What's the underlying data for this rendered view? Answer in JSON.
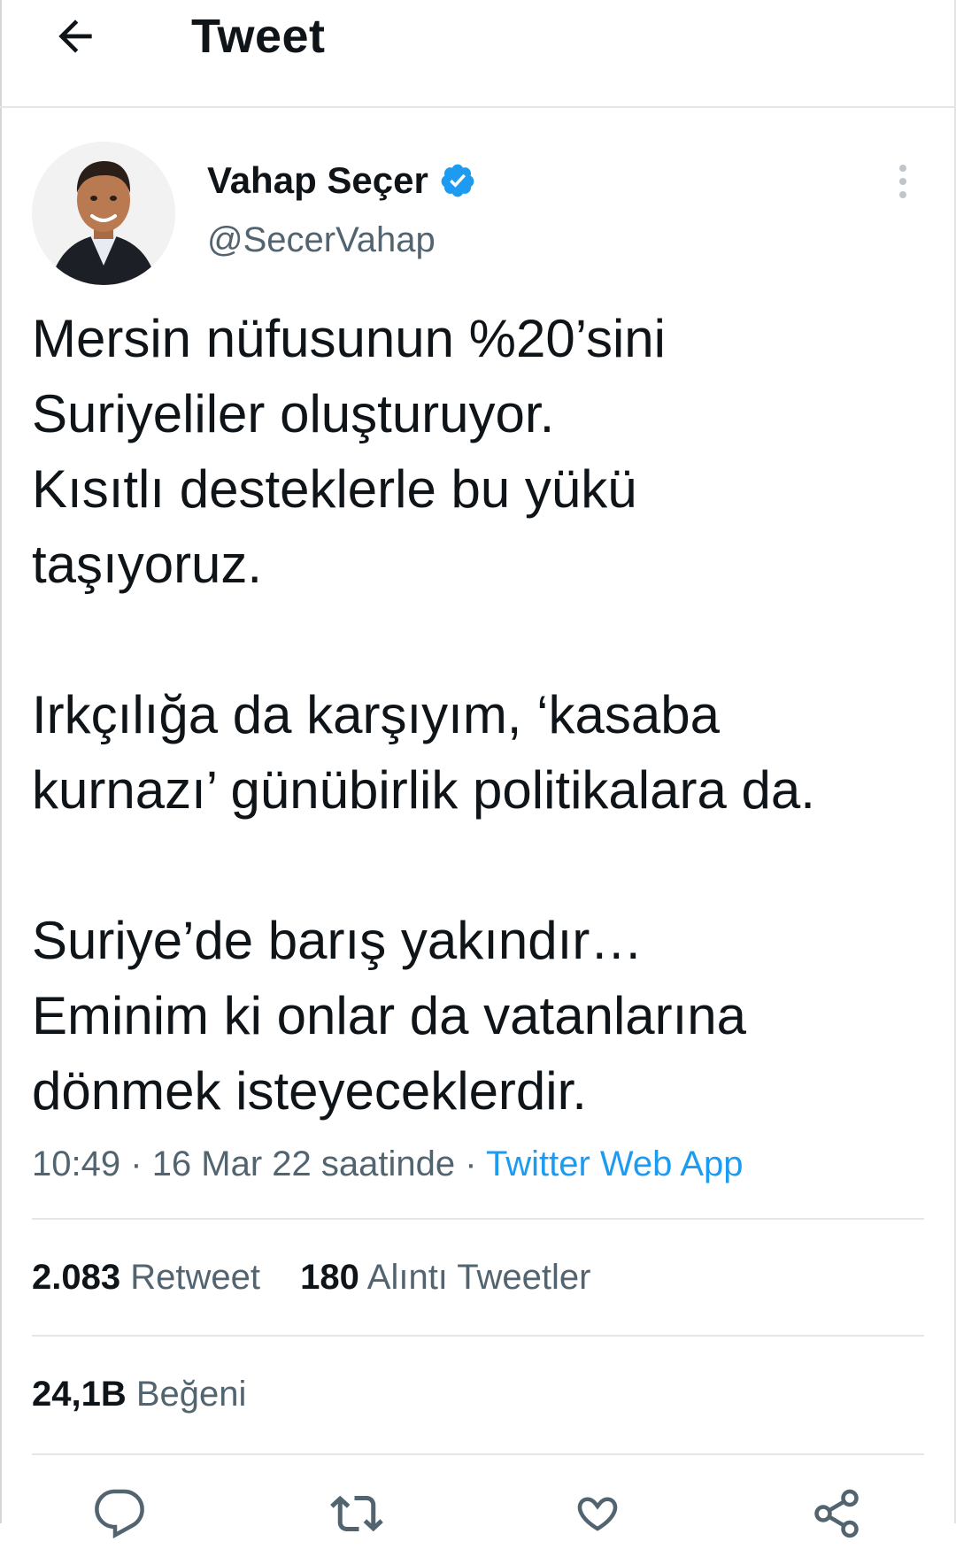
{
  "header": {
    "title": "Tweet"
  },
  "author": {
    "display_name": "Vahap Seçer",
    "handle": "@SecerVahap",
    "verified": true
  },
  "tweet": {
    "lines": [
      "Mersin nüfusunun %20’sini",
      "Suriyeliler oluşturuyor.",
      "Kısıtlı desteklerle bu yükü",
      "taşıyoruz.",
      "",
      "Irkçılığa da karşıyım, ‘kasaba",
      "kurnazı’ günübirlik politikalara da.",
      "",
      "Suriye’de barış yakındır…",
      "Eminim ki onlar da vatanlarına",
      "dönmek isteyeceklerdir."
    ]
  },
  "meta": {
    "time": "10:49",
    "date": "16 Mar 22 saatinde",
    "separator": "·",
    "source": "Twitter Web App"
  },
  "stats": {
    "retweets_count": "2.083",
    "retweets_label": "Retweet",
    "quotes_count": "180",
    "quotes_label": "Alıntı Tweetler",
    "likes_count": "24,1B",
    "likes_label": "Beğeni"
  },
  "colors": {
    "link": "#1d9bf0",
    "muted": "#536471",
    "text": "#0f1419",
    "divider": "#e6e6e6"
  },
  "icons": {
    "back": "arrow-left-icon",
    "verified": "verified-badge-icon",
    "more": "more-vertical-icon",
    "reply": "reply-icon",
    "retweet": "retweet-icon",
    "like": "heart-icon",
    "share": "share-icon"
  }
}
